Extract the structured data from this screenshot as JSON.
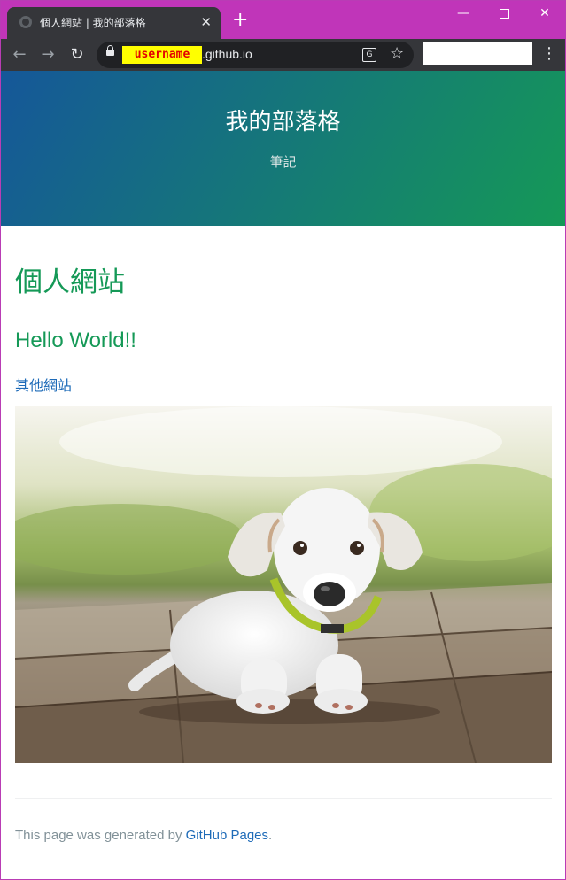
{
  "browser": {
    "tab_title": "個人網站 | 我的部落格",
    "tab_close": "✕",
    "new_tab": "+",
    "url_username": "username",
    "url_domain": ".github.io",
    "translate_glyph": "G",
    "window": {
      "minimize": "—",
      "close": "✕"
    },
    "menu": "⋮",
    "nav": {
      "back": "←",
      "forward": "→",
      "reload": "↻"
    },
    "star": "☆"
  },
  "header": {
    "title": "我的部落格",
    "tagline": "筆記"
  },
  "main": {
    "h1": "個人網站",
    "h2": "Hello World!!",
    "link": "其他網站"
  },
  "footer": {
    "prefix": "This page was generated by ",
    "link": "GitHub Pages",
    "suffix": "."
  },
  "colors": {
    "titlebar": "#c035b9",
    "header_from": "#155799",
    "header_to": "#159957",
    "heading": "#159957",
    "link": "#1e6bb8"
  }
}
